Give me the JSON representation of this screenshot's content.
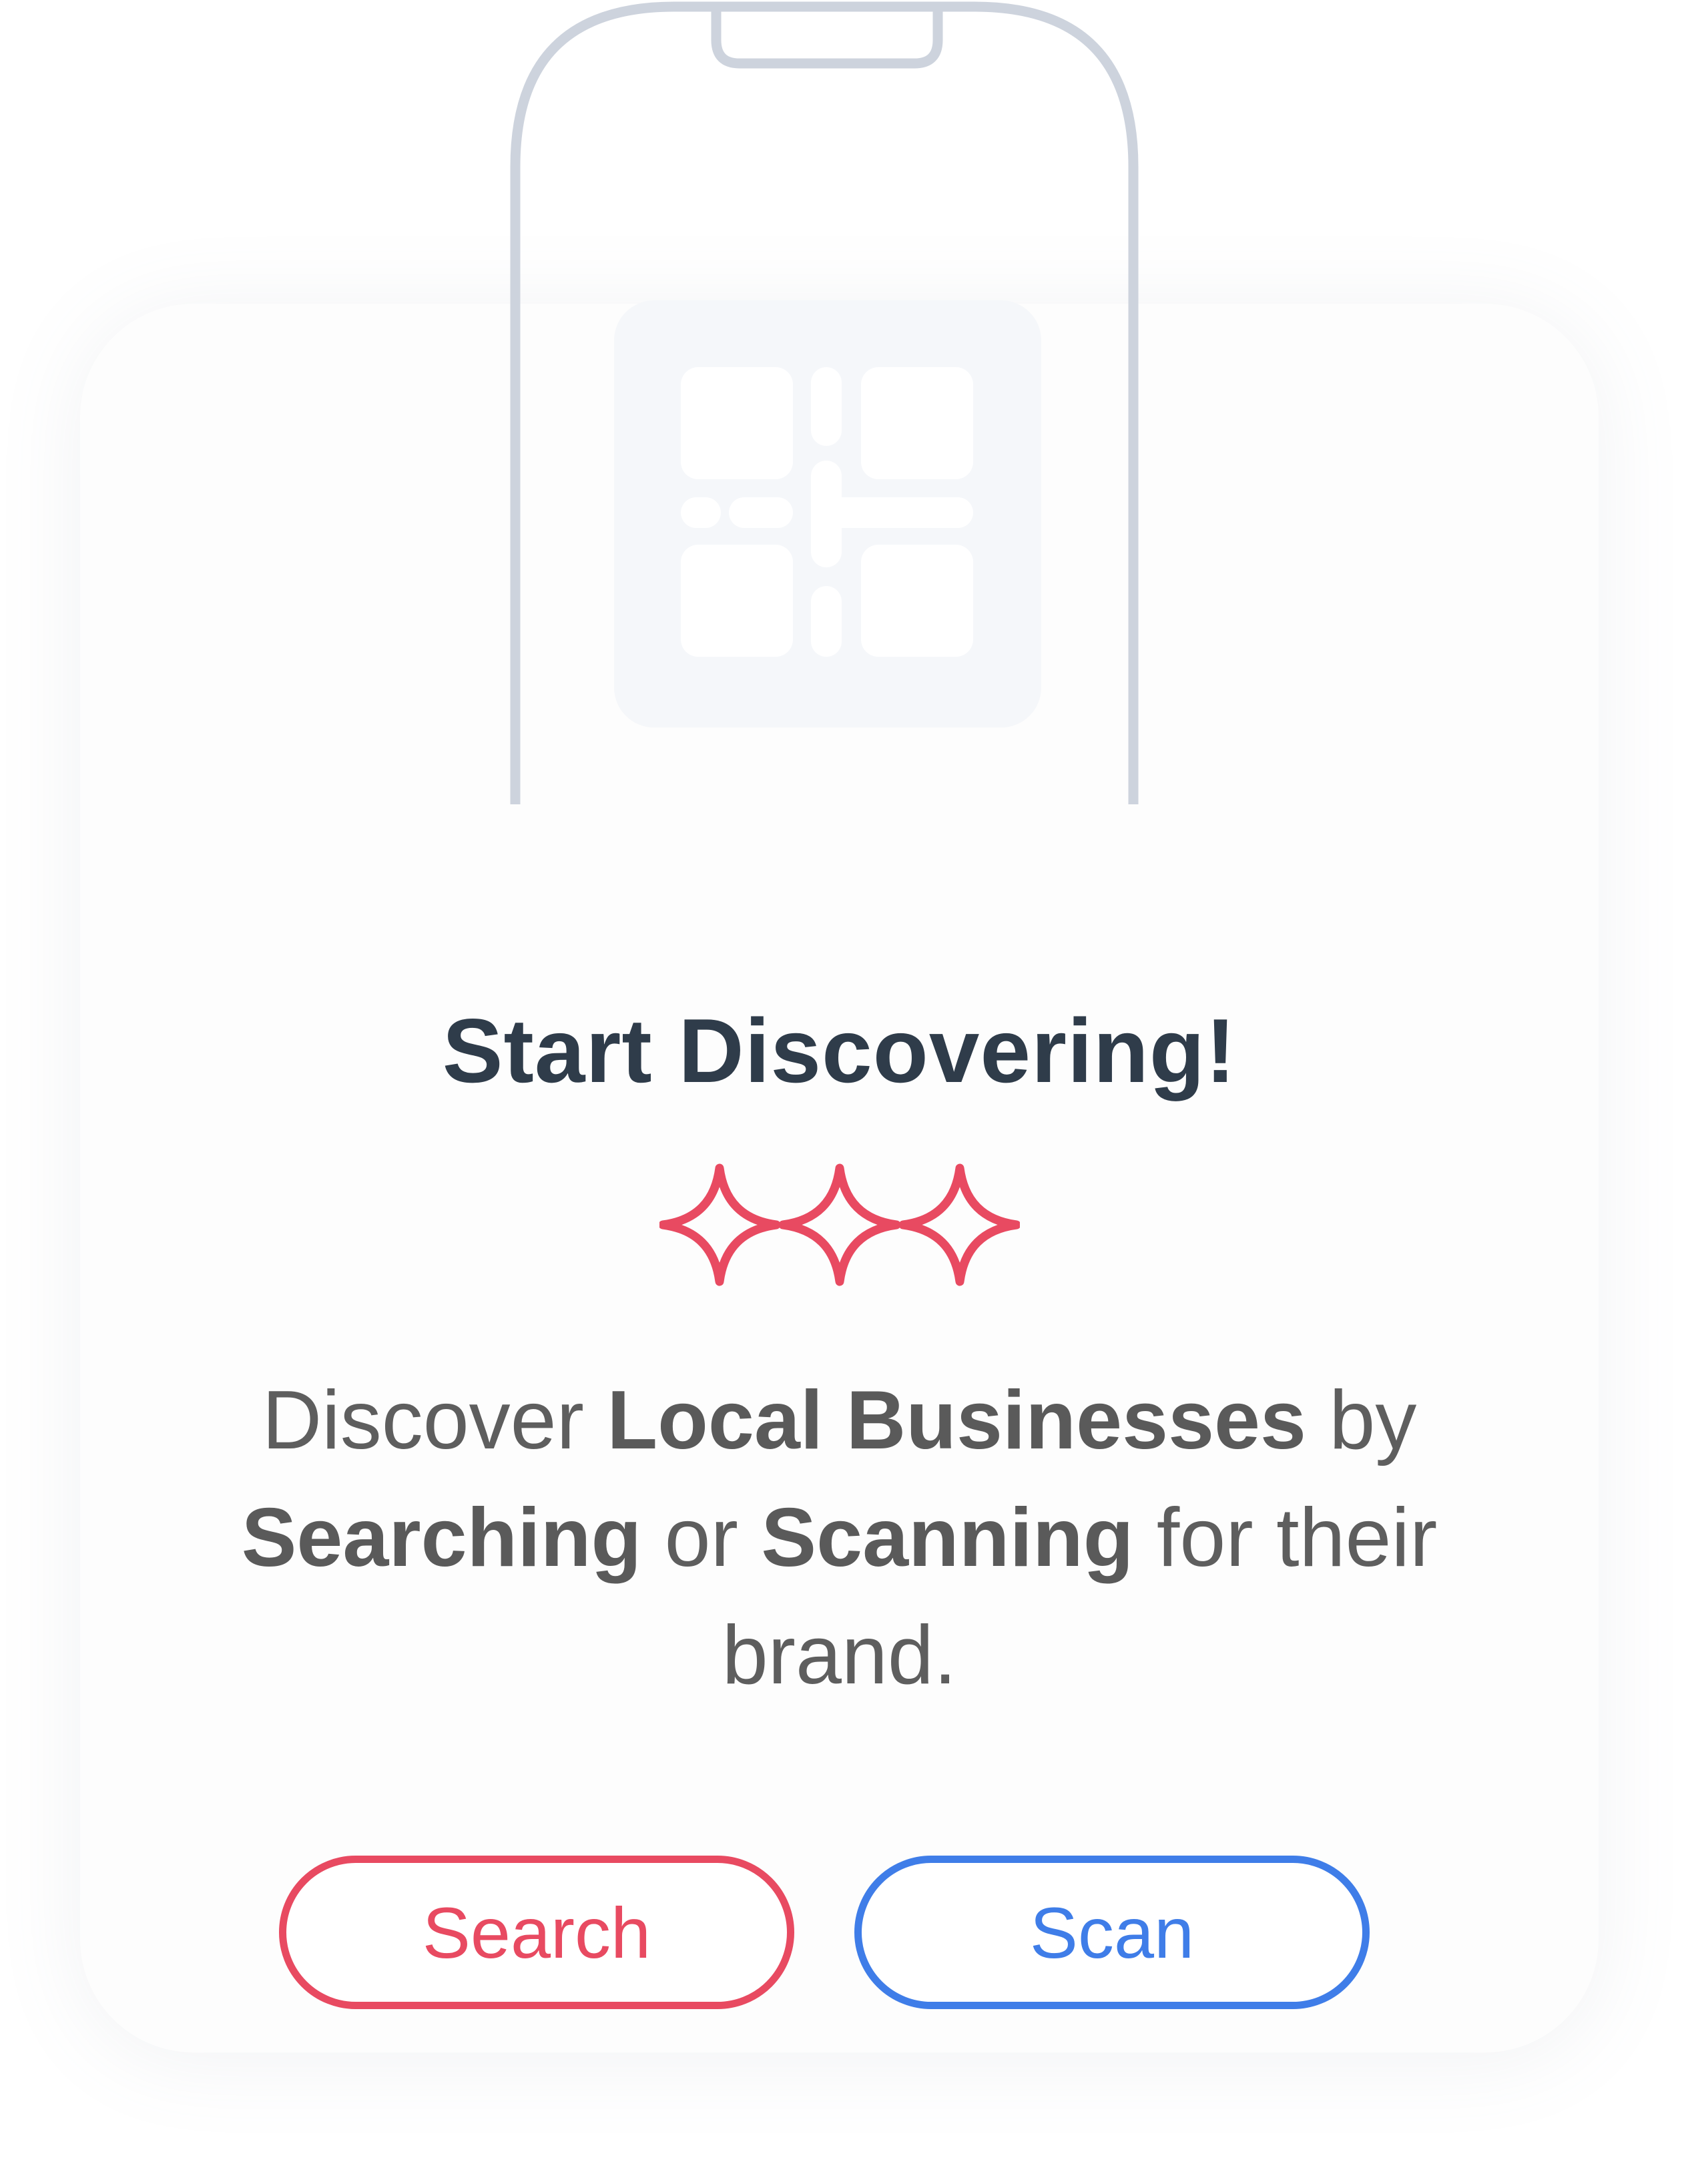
{
  "heading": "Start Discovering!",
  "description": {
    "part1": "Discover ",
    "bold1": "Local Businesses",
    "part2": " by ",
    "bold2": "Searching",
    "part3": " or ",
    "bold3": "Scanning",
    "part4": " for their brand."
  },
  "buttons": {
    "search_label": "Search",
    "scan_label": "Scan"
  },
  "colors": {
    "heading": "#2f3c4a",
    "accent_red": "#e84a61",
    "accent_blue": "#3f7de8",
    "phone_outline": "#cdd3dd",
    "qr_background": "#f5f7fa"
  },
  "icons": {
    "illustration": "phone-qr-illustration",
    "sparkles": "sparkles-icon"
  }
}
